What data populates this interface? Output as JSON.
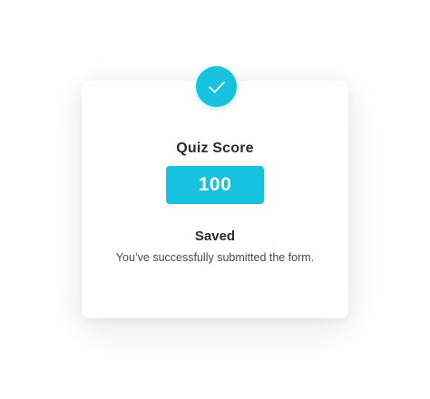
{
  "result": {
    "icon": "checkmark-icon",
    "title": "Quiz Score",
    "score": "100",
    "status": "Saved",
    "message": "You’ve successfully submitted the form."
  },
  "colors": {
    "accent": "#17c2df",
    "card_background": "#ffffff",
    "text": "#2b2b2b"
  }
}
